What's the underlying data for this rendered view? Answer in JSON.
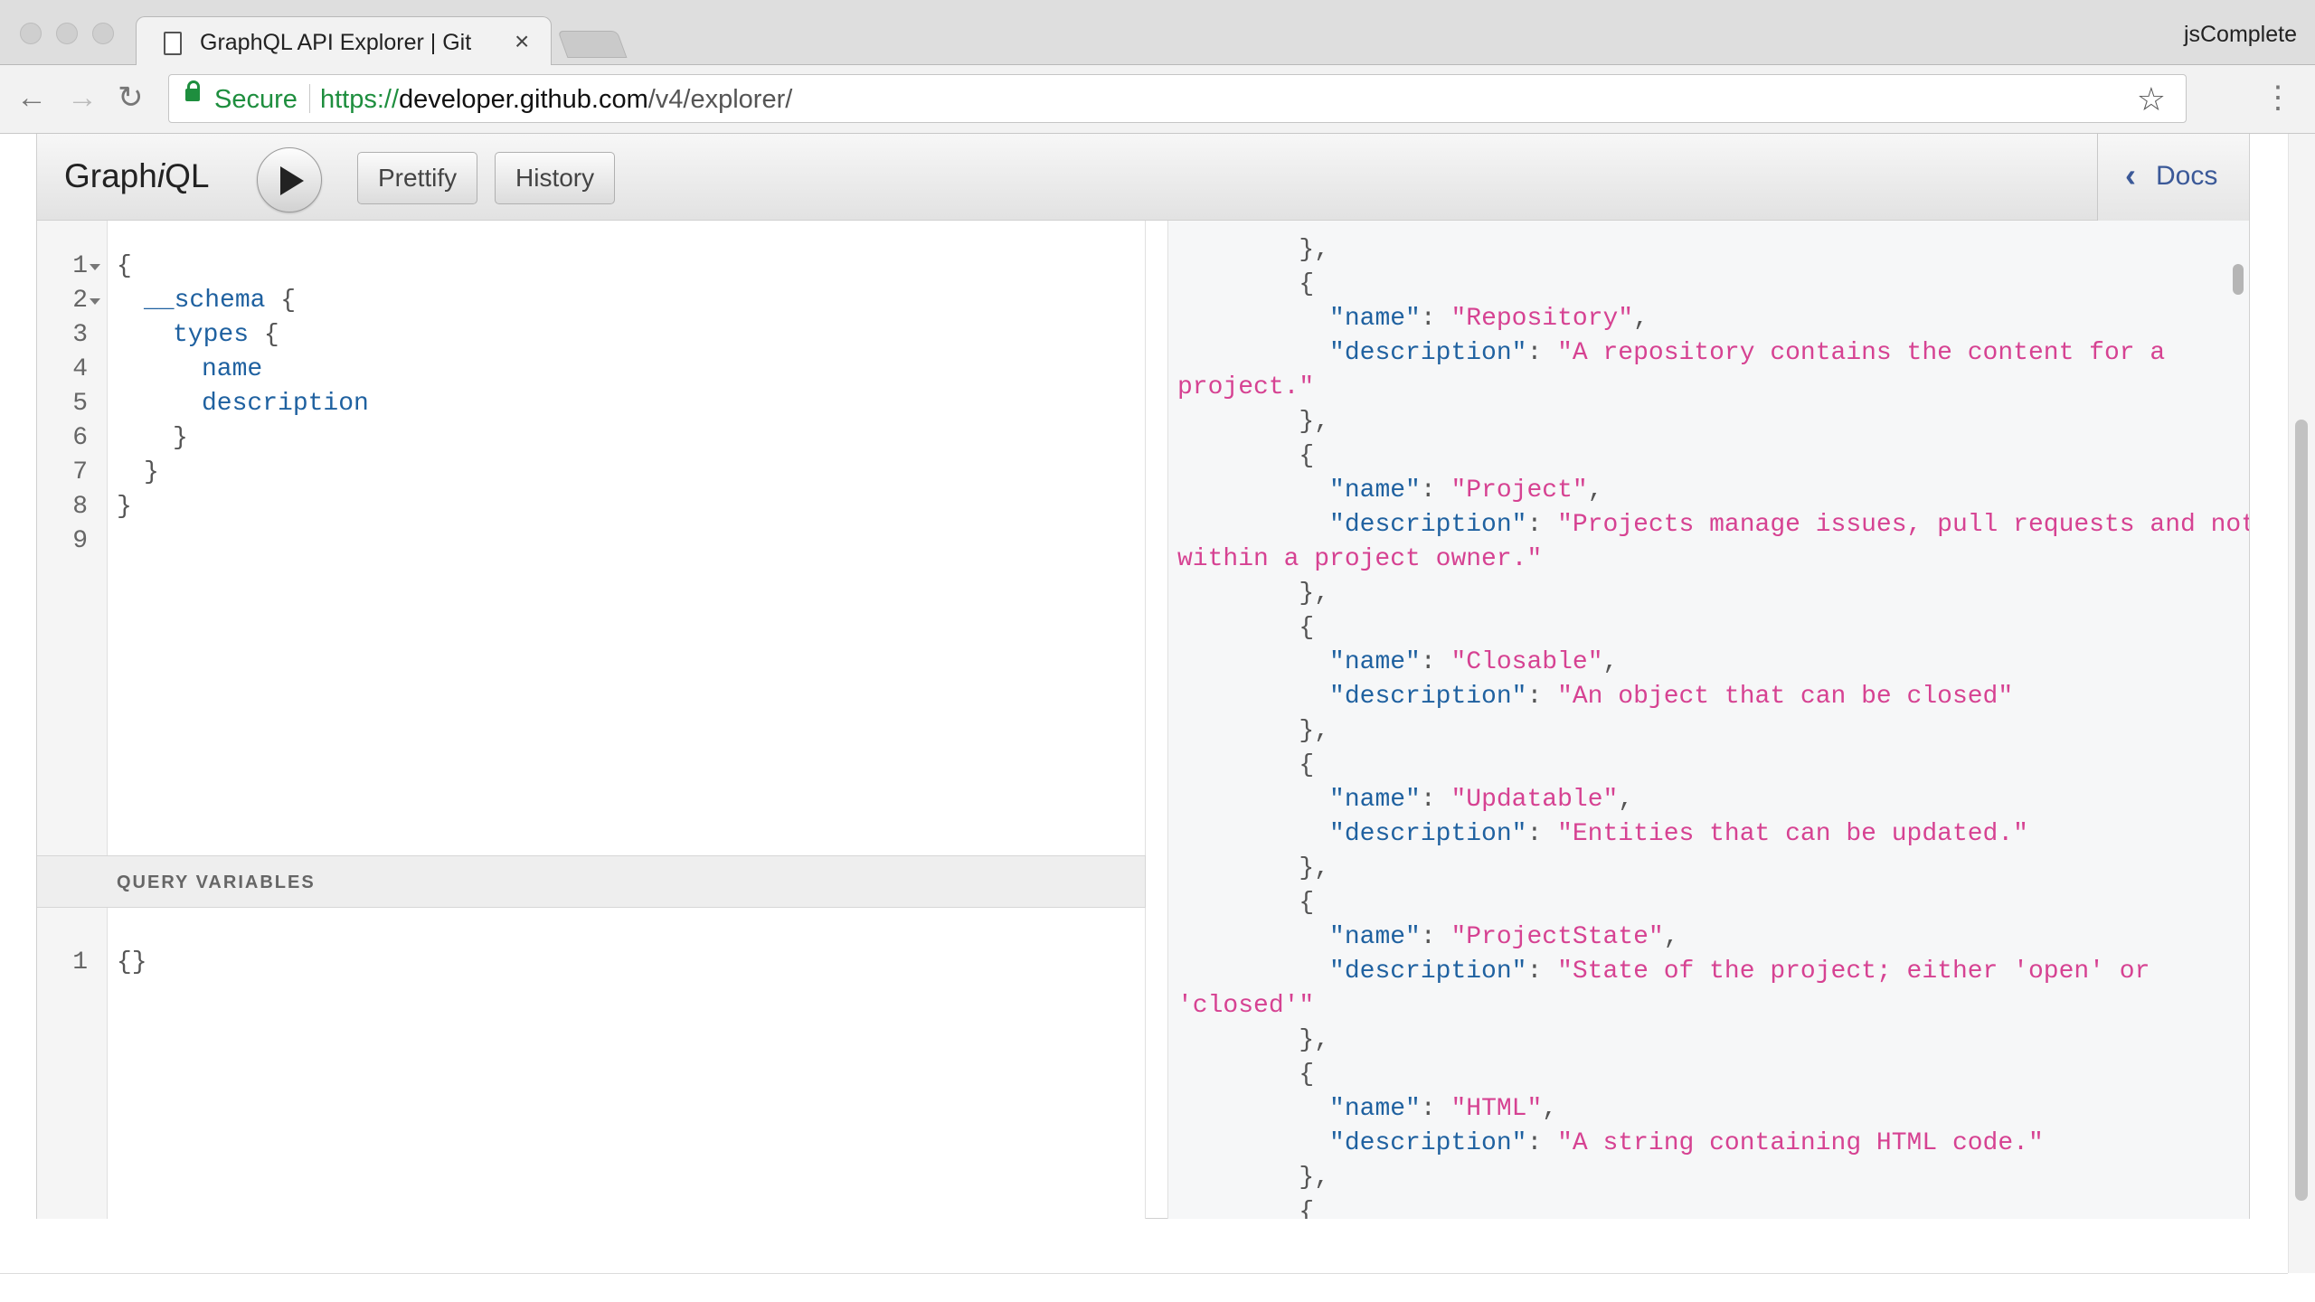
{
  "browser": {
    "tab_title": "GraphQL API Explorer | GitHub",
    "tab_close": "×",
    "profile_name": "jsComplete",
    "secure_label": "Secure",
    "url_scheme": "https://",
    "url_host": "developer.github.com",
    "url_path": "/v4/explorer/",
    "icons": {
      "back": "back-arrow-icon",
      "forward": "forward-arrow-icon",
      "reload": "reload-icon",
      "star": "bookmark-star-icon",
      "menu": "menu-dots-icon"
    }
  },
  "graphiql": {
    "logo_pre": "Graph",
    "logo_i": "i",
    "logo_post": "QL",
    "prettify_label": "Prettify",
    "history_label": "History",
    "docs_label": "Docs",
    "query_variables_title": "QUERY VARIABLES"
  },
  "query_editor": {
    "line_numbers": [
      "1",
      "2",
      "3",
      "4",
      "5",
      "6",
      "7",
      "8",
      "9"
    ],
    "lines": {
      "l1": "{",
      "l2_field": "__schema",
      "l2_brace": " {",
      "l3_field": "types",
      "l3_brace": " {",
      "l4_field": "name",
      "l5_field": "description",
      "l6": "}",
      "l7": "}",
      "l8": "}"
    }
  },
  "variables_editor": {
    "line_numbers": [
      "1"
    ],
    "content": "{}"
  },
  "result": {
    "entries": [
      {
        "name": "Repository",
        "description_lines": [
          "A repository contains the content for a",
          "project."
        ]
      },
      {
        "name": "Project",
        "description_lines": [
          "Projects manage issues, pull requests and notes",
          "within a project owner."
        ]
      },
      {
        "name": "Closable",
        "description_lines": [
          "An object that can be closed"
        ]
      },
      {
        "name": "Updatable",
        "description_lines": [
          "Entities that can be updated."
        ]
      },
      {
        "name": "ProjectState",
        "description_lines": [
          "State of the project; either 'open' or",
          "'closed'"
        ]
      },
      {
        "name": "HTML",
        "description_lines": [
          "A string containing HTML code."
        ]
      }
    ],
    "labels": {
      "name_key": "\"name\"",
      "description_key": "\"description\"",
      "open_brace": "{",
      "close_brace": "},",
      "colon": ": ",
      "comma": ","
    }
  }
}
